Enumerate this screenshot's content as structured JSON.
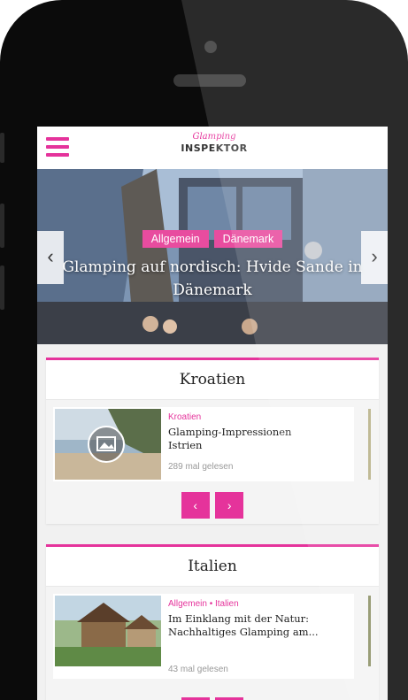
{
  "colors": {
    "accent": "#e5339b",
    "frame": "#0b0b0b"
  },
  "header": {
    "logo_script": "Glamping",
    "logo_main": "INSPEKTOR",
    "menu_icon": "hamburger-icon"
  },
  "hero": {
    "tags": [
      "Allgemein",
      "Dänemark"
    ],
    "title": "Glamping auf nordisch: Hvide Sande in Dänemark",
    "prev": "‹",
    "next": "›"
  },
  "sections": [
    {
      "title": "Kroatien",
      "card": {
        "category": "Kroatien",
        "title": "Glamping-Impressionen Istrien",
        "reads": "289 mal gelesen",
        "image_icon": "image-icon"
      },
      "pager": {
        "prev": "‹",
        "next": "›"
      }
    },
    {
      "title": "Italien",
      "card": {
        "category": "Allgemein • Italien",
        "title": "Im Einklang mit der Natur: Nachhaltiges Glamping am...",
        "reads": "43 mal gelesen"
      }
    }
  ]
}
